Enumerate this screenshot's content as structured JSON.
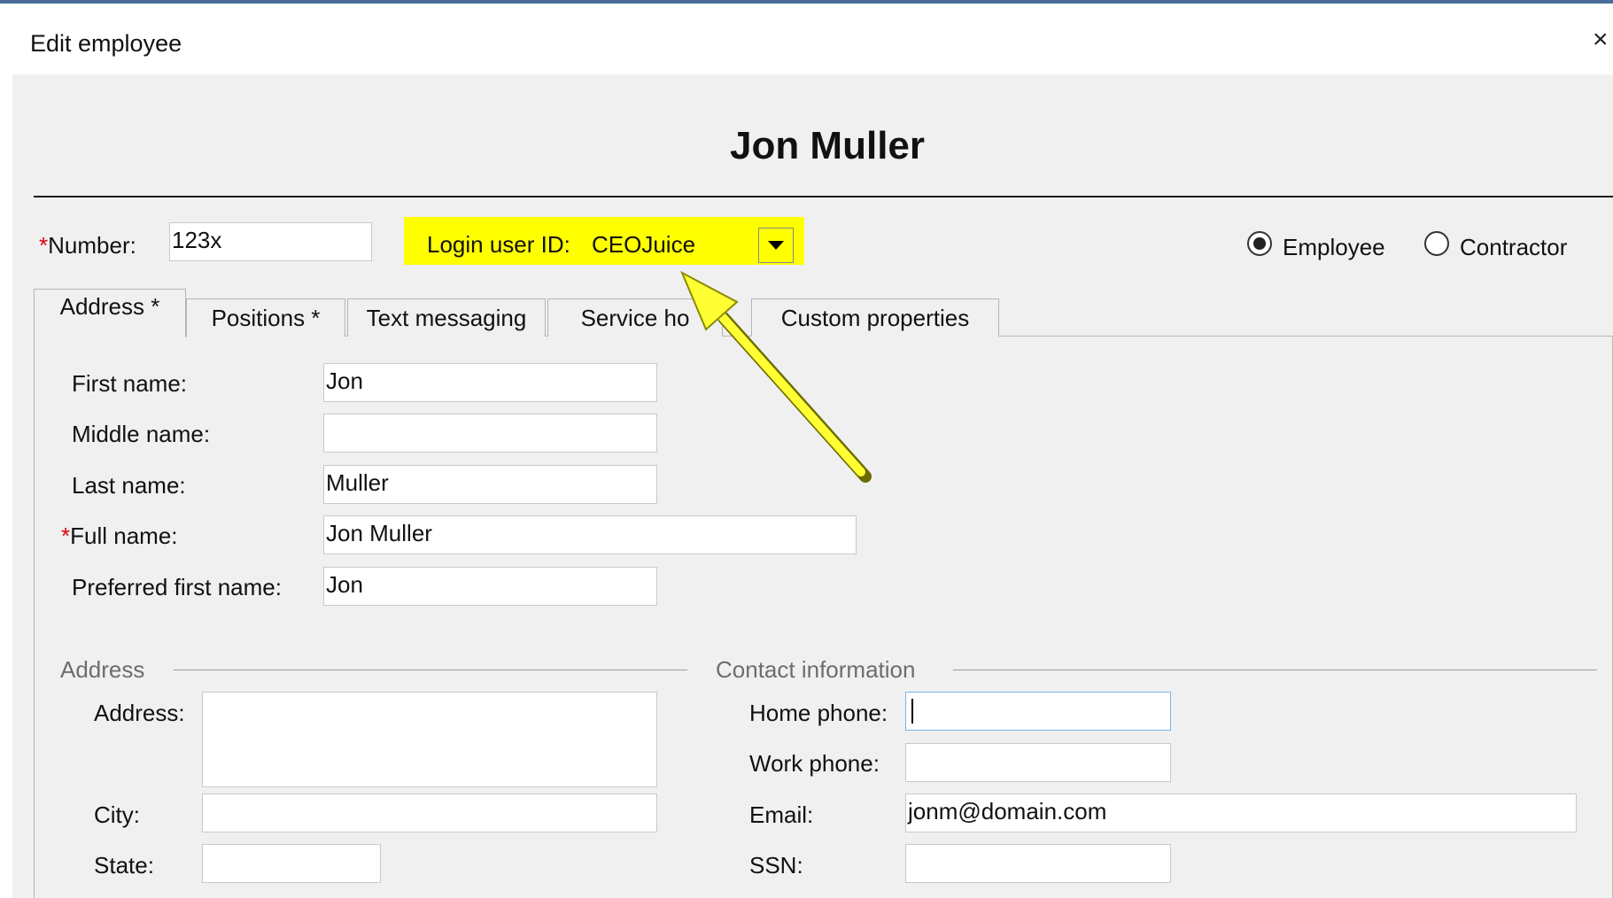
{
  "window": {
    "title": "Edit employee",
    "close_glyph": "×"
  },
  "header": {
    "employee_name": "Jon Muller"
  },
  "top_row": {
    "number_required_mark": "*",
    "number_label": "Number:",
    "number_value": "123x",
    "login_label": "Login user ID:",
    "login_value": "CEOJuice",
    "radio_employee": "Employee",
    "radio_contractor": "Contractor",
    "selected_type": "Employee"
  },
  "tabs": [
    {
      "label": "Address *",
      "active": true
    },
    {
      "label": "Positions *",
      "active": false
    },
    {
      "label": "Text messaging",
      "active": false
    },
    {
      "label": "Service ho",
      "active": false
    },
    {
      "label": "Custom properties",
      "active": false
    }
  ],
  "name_fields": {
    "first_name_label": "First name:",
    "first_name_value": "Jon",
    "middle_name_label": "Middle name:",
    "middle_name_value": "",
    "last_name_label": "Last name:",
    "last_name_value": "Muller",
    "full_name_required_mark": "*",
    "full_name_label": "Full name:",
    "full_name_value": "Jon Muller",
    "preferred_label": "Preferred first name:",
    "preferred_value": "Jon"
  },
  "address_group": {
    "title": "Address",
    "address_label": "Address:",
    "address_value": "",
    "city_label": "City:",
    "city_value": "",
    "state_label": "State:",
    "state_value": ""
  },
  "contact_group": {
    "title": "Contact information",
    "home_phone_label": "Home phone:",
    "home_phone_value": "",
    "work_phone_label": "Work phone:",
    "work_phone_value": "",
    "email_label": "Email:",
    "email_value": "jonm@domain.com",
    "ssn_label": "SSN:",
    "ssn_value": ""
  },
  "annotation": {
    "highlight_color": "#ffff00",
    "arrow_color": "#ffff33"
  },
  "icons": {
    "dropdown": "chevron-down-icon",
    "close": "close-icon"
  }
}
